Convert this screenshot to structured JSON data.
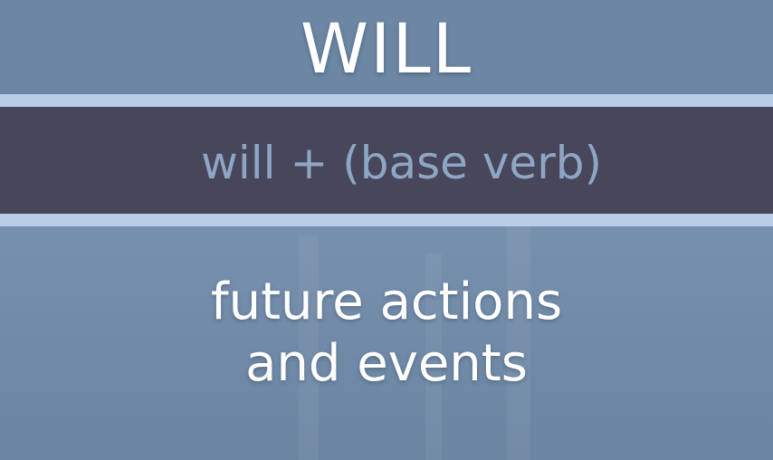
{
  "heading": "WILL",
  "formula": "will + (base verb)",
  "description": {
    "line1": "future actions",
    "line2": "and events"
  }
}
